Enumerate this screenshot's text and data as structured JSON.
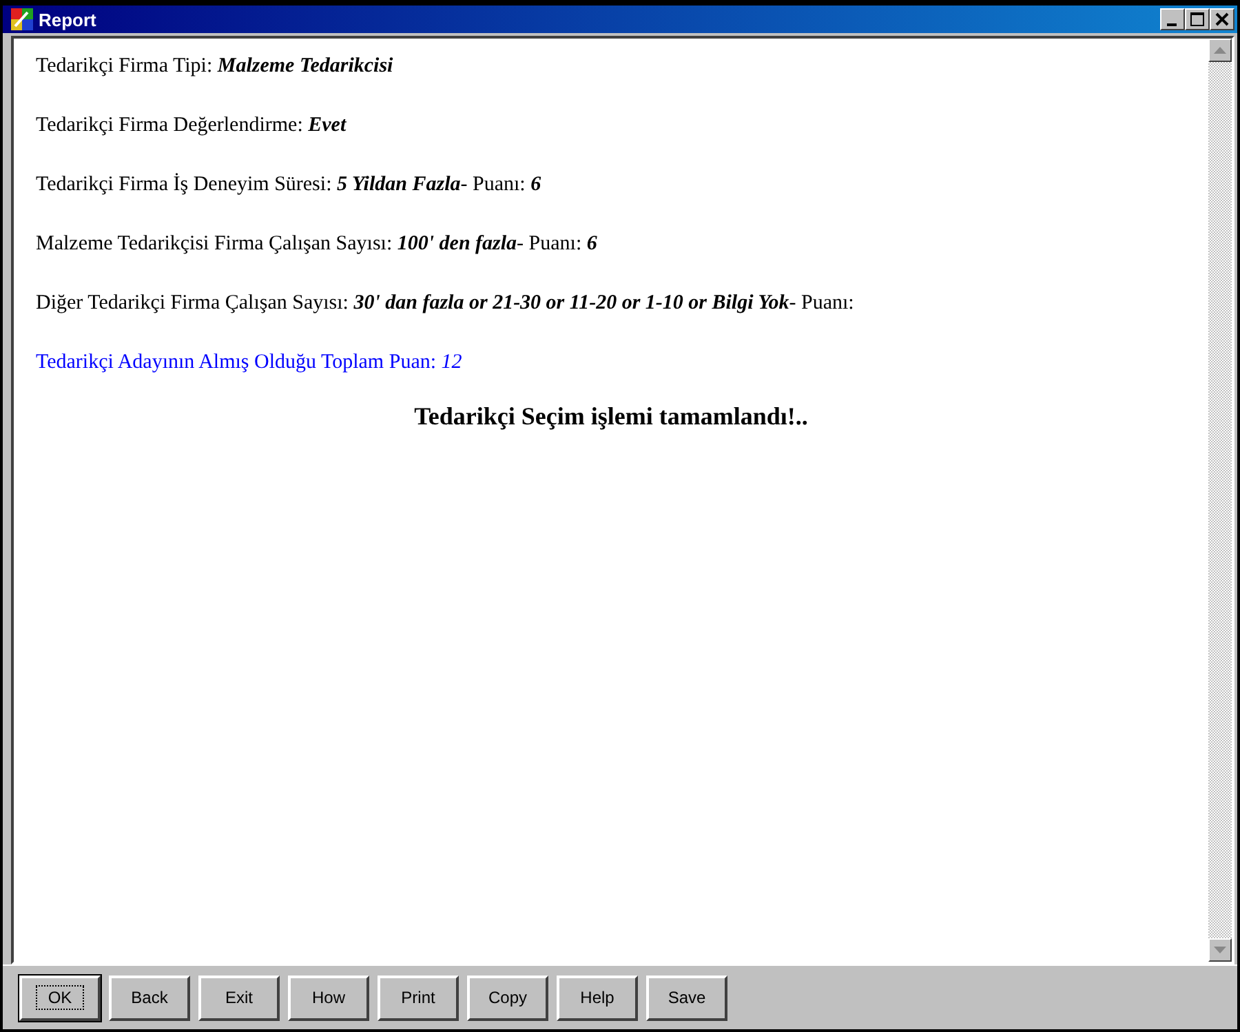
{
  "window": {
    "title": "Report"
  },
  "lines": [
    {
      "kind": "field",
      "label": "Tedarikçi Firma Tipi: ",
      "value": "Malzeme Tedarikcisi"
    },
    {
      "kind": "field",
      "label": "Tedarikçi Firma Değerlendirme: ",
      "value": "Evet"
    },
    {
      "kind": "field",
      "label": "Tedarikçi Firma İş Deneyim Süresi: ",
      "value": "5 Yildan Fazla",
      "tail": "- Puanı: ",
      "score": "6"
    },
    {
      "kind": "field",
      "label": "Malzeme Tedarikçisi Firma Çalışan Sayısı: ",
      "value": "100' den fazla",
      "tail": "- Puanı: ",
      "score": "6"
    },
    {
      "kind": "field",
      "label": "Diğer Tedarikçi Firma Çalışan Sayısı: ",
      "value": "30' dan fazla or 21-30 or 11-20 or 1-10 or Bilgi Yok",
      "tail": "- Puanı:"
    },
    {
      "kind": "total",
      "label": "Tedarikçi Adayının Almış Olduğu Toplam Puan: ",
      "value": "12"
    }
  ],
  "message": "Tedarikçi Seçim işlemi tamamlandı!..",
  "buttons": [
    {
      "label": "OK",
      "focused": true
    },
    {
      "label": "Back",
      "focused": false
    },
    {
      "label": "Exit",
      "focused": false
    },
    {
      "label": "How",
      "focused": false
    },
    {
      "label": "Print",
      "focused": false
    },
    {
      "label": "Copy",
      "focused": false
    },
    {
      "label": "Help",
      "focused": false
    },
    {
      "label": "Save",
      "focused": false
    }
  ]
}
